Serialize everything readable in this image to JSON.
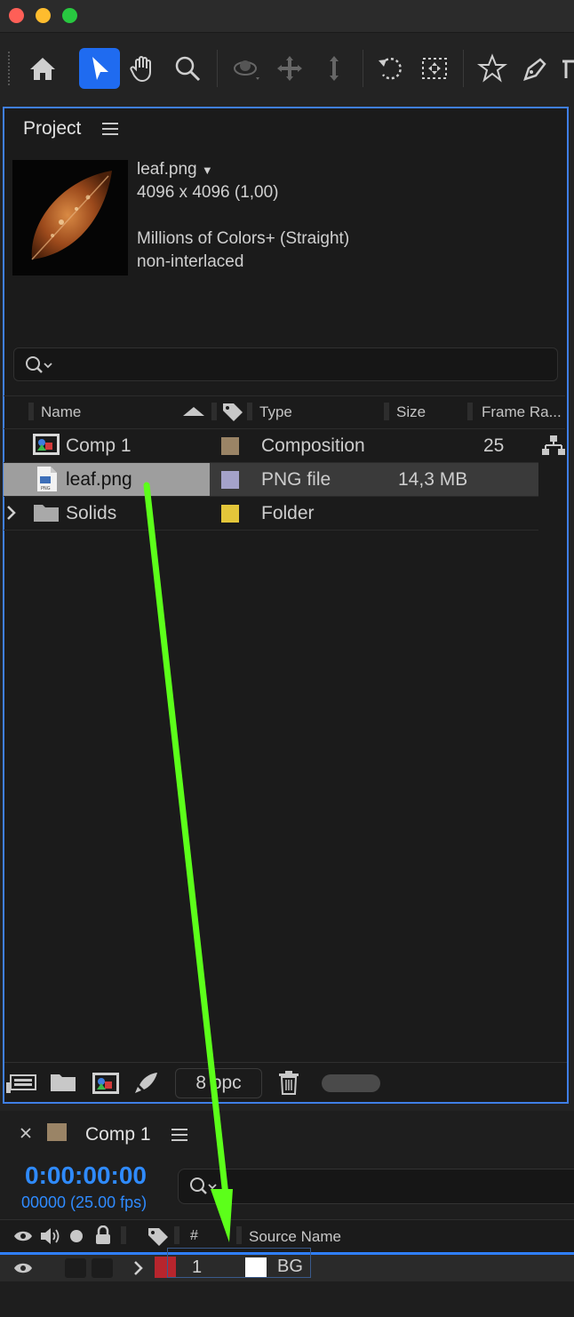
{
  "toolbar": {
    "tools": [
      "home-icon",
      "selection-tool-icon",
      "hand-tool-icon",
      "zoom-tool-icon",
      "orbit-camera-icon",
      "pan-camera-icon",
      "dolly-camera-icon",
      "rotate-tool-icon",
      "pan-behind-tool-icon",
      "shape-tool-icon",
      "pen-tool-icon",
      "type-tool-icon"
    ]
  },
  "project": {
    "title": "Project",
    "preview": {
      "name": "leaf.png",
      "dimensions": "4096 x 4096 (1,00)",
      "color": "Millions of Colors+ (Straight)",
      "interlace": "non-interlaced"
    },
    "search_placeholder": "",
    "columns": {
      "name": "Name",
      "type": "Type",
      "size": "Size",
      "frame_rate": "Frame Ra..."
    },
    "items": [
      {
        "name": "Comp 1",
        "type": "Composition",
        "size": "",
        "frame_rate": "25",
        "label_color": "#9a8466",
        "icon": "composition-icon"
      },
      {
        "name": "leaf.png",
        "type": "PNG file",
        "size": "14,3 MB",
        "frame_rate": "",
        "label_color": "#a4a2c9",
        "icon": "png-file-icon"
      },
      {
        "name": "Solids",
        "type": "Folder",
        "size": "",
        "frame_rate": "",
        "label_color": "#e3c63a",
        "icon": "folder-icon"
      }
    ],
    "bpc": "8 bpc"
  },
  "timeline": {
    "tab": "Comp 1",
    "timecode": "0:00:00:00",
    "frames": "00000 (25.00 fps)",
    "columns": {
      "num": "#",
      "source_name": "Source Name"
    },
    "layer": {
      "num": "1",
      "name": "BG"
    }
  },
  "colors": {
    "accent": "#2f7fff",
    "arrow": "#5cff1a"
  }
}
